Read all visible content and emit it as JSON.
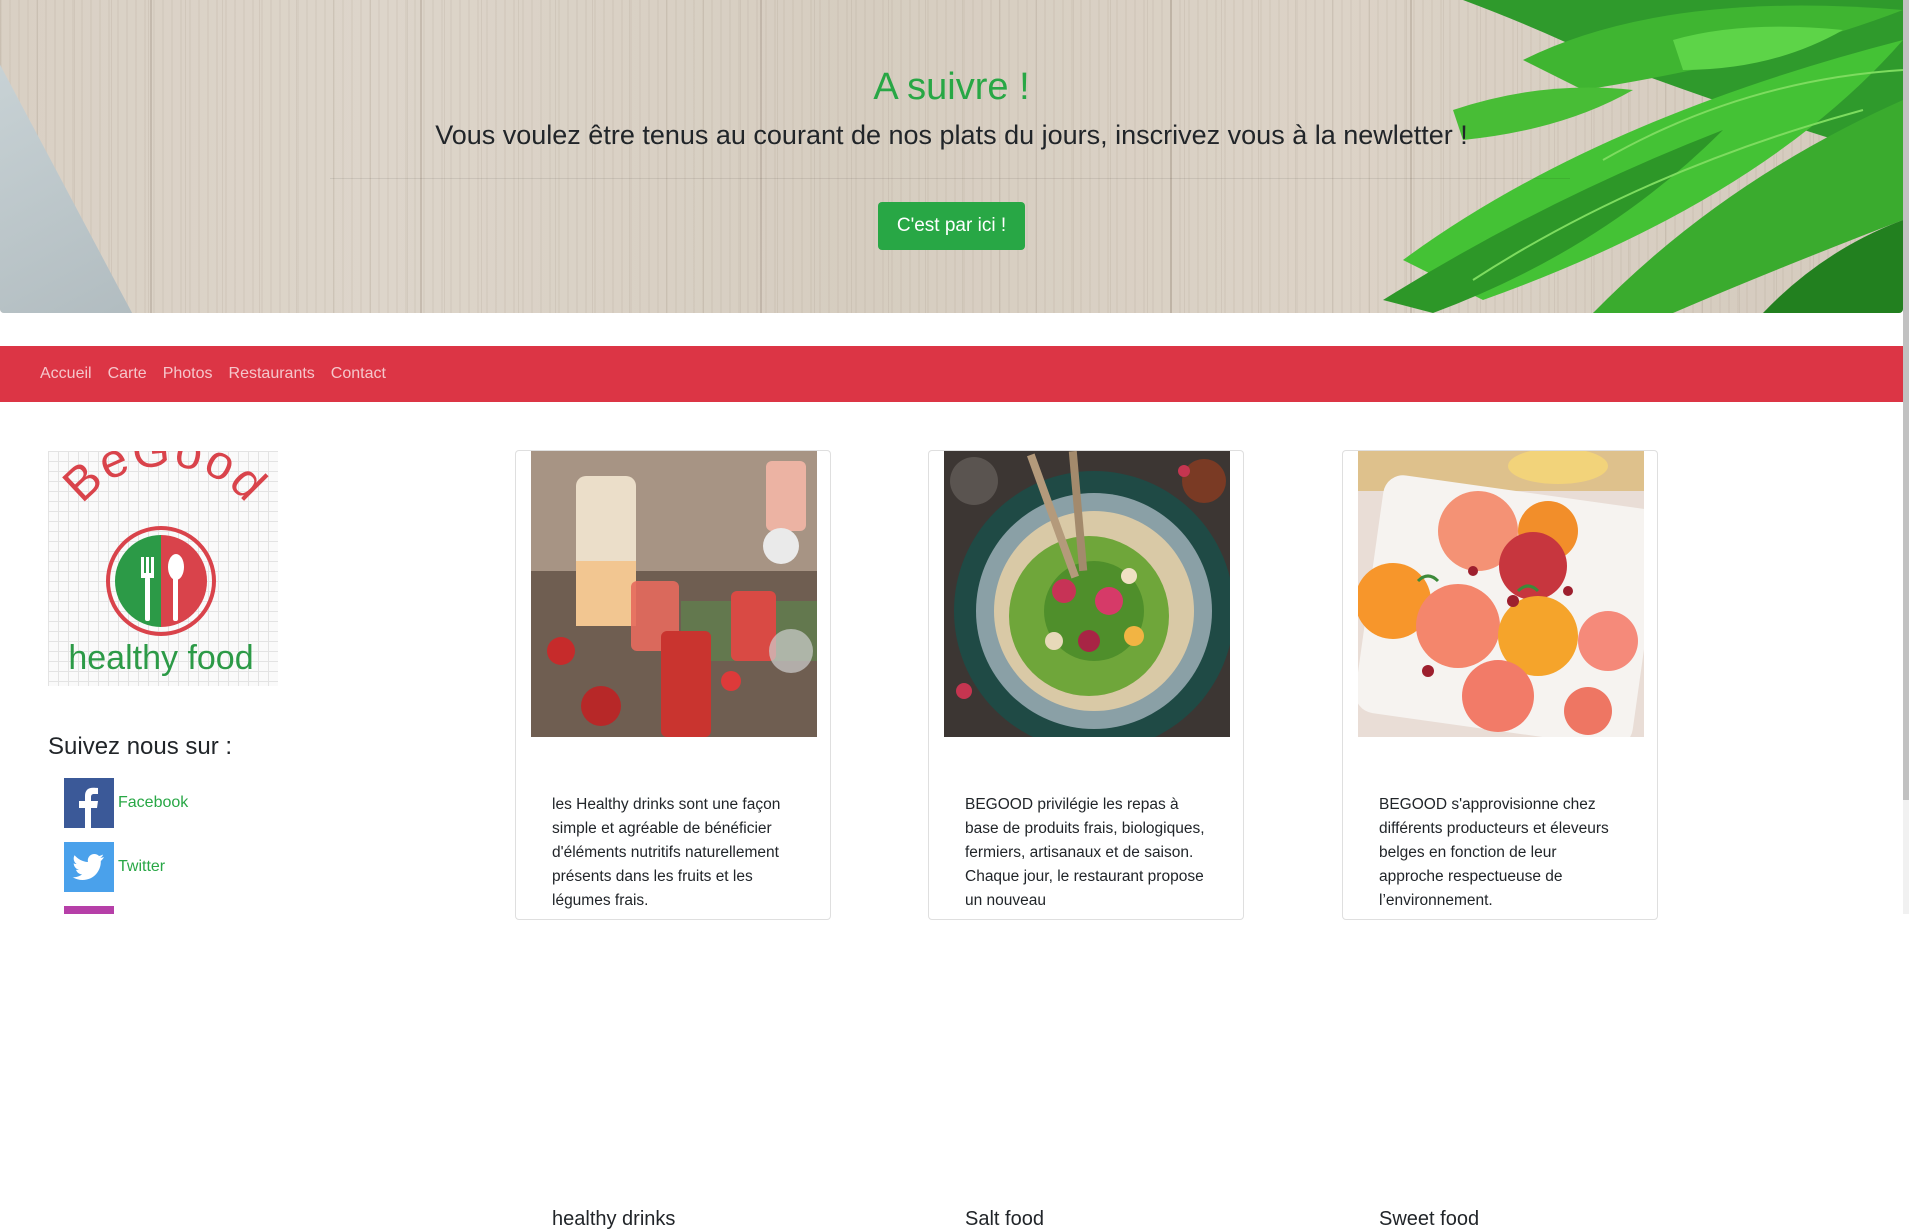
{
  "hero": {
    "title": "A suivre !",
    "subtitle": "Vous voulez être tenus au courant de nos plats du jours, inscrivez vous à la newletter !",
    "button_label": "C'est par ici !"
  },
  "nav": {
    "items": [
      {
        "label": "Accueil"
      },
      {
        "label": "Carte"
      },
      {
        "label": "Photos"
      },
      {
        "label": "Restaurants"
      },
      {
        "label": "Contact"
      }
    ]
  },
  "logo": {
    "brand_top": "BeGood",
    "brand_bottom": "healthy food"
  },
  "social": {
    "title": "Suivez nous sur :",
    "links": [
      {
        "label": "Facebook",
        "icon": "facebook-icon"
      },
      {
        "label": "Twitter",
        "icon": "twitter-icon"
      }
    ]
  },
  "cards": [
    {
      "title": "healthy drinks",
      "text": "les Healthy drinks sont une façon simple et agréable de bénéficier d'éléments nutritifs naturellement présents dans les fruits et les légumes frais."
    },
    {
      "title": "Salt food",
      "text": "BEGOOD privilégie les repas à base de produits frais, biologiques, fermiers, artisanaux et de saison. Chaque jour, le restaurant propose un nouveau"
    },
    {
      "title": "Sweet food",
      "text": "BEGOOD s'approvisionne chez différents producteurs et éleveurs belges en fonction de leur approche respectueuse de l’environnement."
    }
  ],
  "colors": {
    "accent_green": "#28a745",
    "nav_red": "#dc3545",
    "logo_red": "#d9434b",
    "logo_green": "#2c9a47"
  }
}
